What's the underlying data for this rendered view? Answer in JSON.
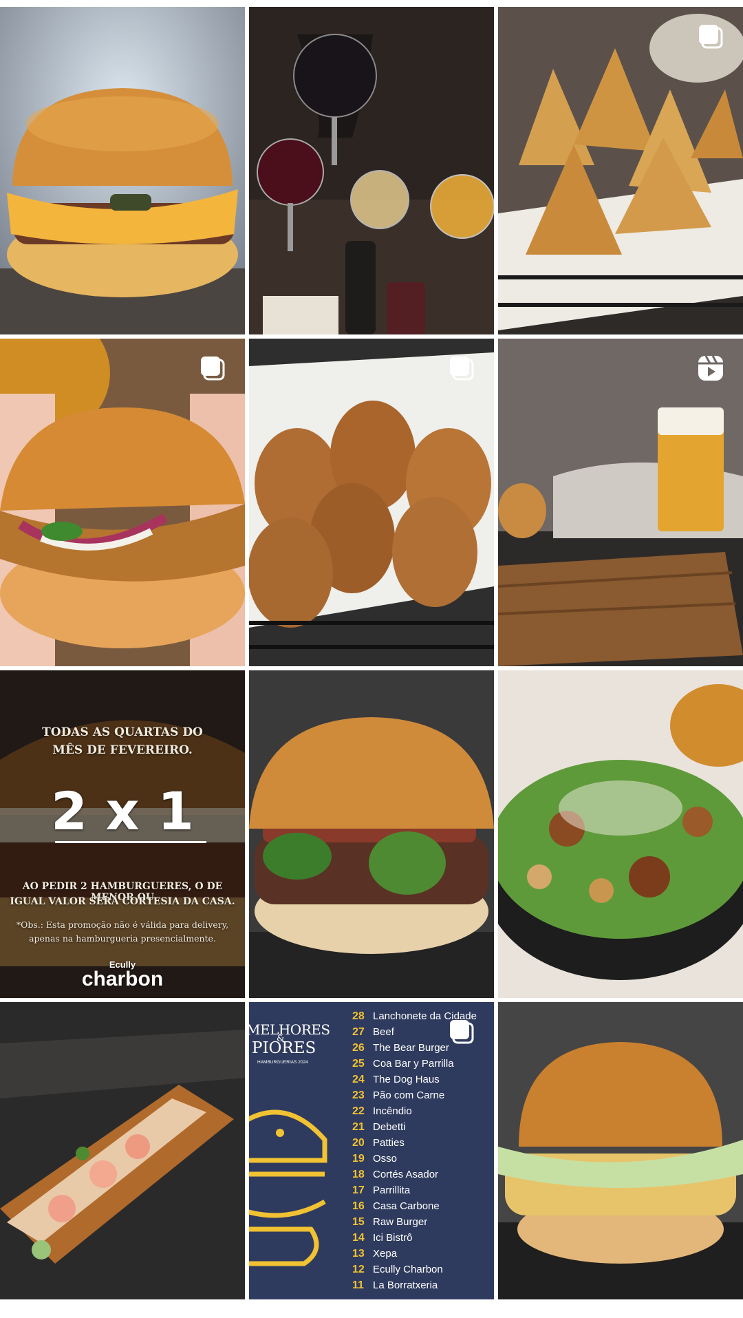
{
  "grid": {
    "posts": [
      {
        "subject": "cheeseburger",
        "badge": ""
      },
      {
        "subject": "wine and cocktails",
        "badge": ""
      },
      {
        "subject": "coxinhas in basket",
        "badge": "carousel-icon"
      },
      {
        "subject": "fried chicken sandwich",
        "badge": "carousel-icon"
      },
      {
        "subject": "churros madeleines",
        "badge": "carousel-icon"
      },
      {
        "subject": "beer and cutting board",
        "badge": "reels-icon"
      },
      {
        "subject": "promo 2x1 burger",
        "badge": ""
      },
      {
        "subject": "burger with basil",
        "badge": ""
      },
      {
        "subject": "caesar salad",
        "badge": ""
      },
      {
        "subject": "shrimp roll",
        "badge": ""
      },
      {
        "subject": "burger ranking list",
        "badge": "carousel-icon"
      },
      {
        "subject": "burger with lettuce",
        "badge": ""
      }
    ]
  },
  "promo": {
    "line1": "TODAS AS QUARTAS DO",
    "line2": "MÊS DE FEVEREIRO.",
    "offer": "2 x 1",
    "desc1": "AO PEDIR 2 HAMBURGUERES, O DE MENOR OU",
    "desc2": "IGUAL VALOR SERÁ CORTESIA DA CASA.",
    "obs1": "*Obs.: Esta promoção não é válida  para delivery,",
    "obs2": "apenas na hamburgueria presencialmente.",
    "brand_small": "Ecully",
    "brand": "charbon"
  },
  "ranking": {
    "title1": "MELHORES",
    "amp": "&",
    "title2": "PIORES",
    "subtitle": "HAMBURGUERIAS 2024",
    "items": [
      {
        "rank": "28",
        "name": "Lanchonete da Cidade"
      },
      {
        "rank": "27",
        "name": "Beef"
      },
      {
        "rank": "26",
        "name": "The Bear Burger"
      },
      {
        "rank": "25",
        "name": "Coa Bar y Parrilla"
      },
      {
        "rank": "24",
        "name": "The Dog Haus"
      },
      {
        "rank": "23",
        "name": "Pão com Carne"
      },
      {
        "rank": "22",
        "name": "Incêndio"
      },
      {
        "rank": "21",
        "name": "Debetti"
      },
      {
        "rank": "20",
        "name": "Patties"
      },
      {
        "rank": "19",
        "name": "Osso"
      },
      {
        "rank": "18",
        "name": "Cortés Asador"
      },
      {
        "rank": "17",
        "name": "Parrillita"
      },
      {
        "rank": "16",
        "name": "Casa Carbone"
      },
      {
        "rank": "15",
        "name": "Raw Burger"
      },
      {
        "rank": "14",
        "name": "Ici Bistrô"
      },
      {
        "rank": "13",
        "name": "Xepa"
      },
      {
        "rank": "12",
        "name": "Ecully Charbon"
      },
      {
        "rank": "11",
        "name": "La Borratxeria"
      }
    ]
  },
  "colors": {
    "ranking_bg": "#2f3b5e",
    "ranking_accent": "#f1c232"
  }
}
